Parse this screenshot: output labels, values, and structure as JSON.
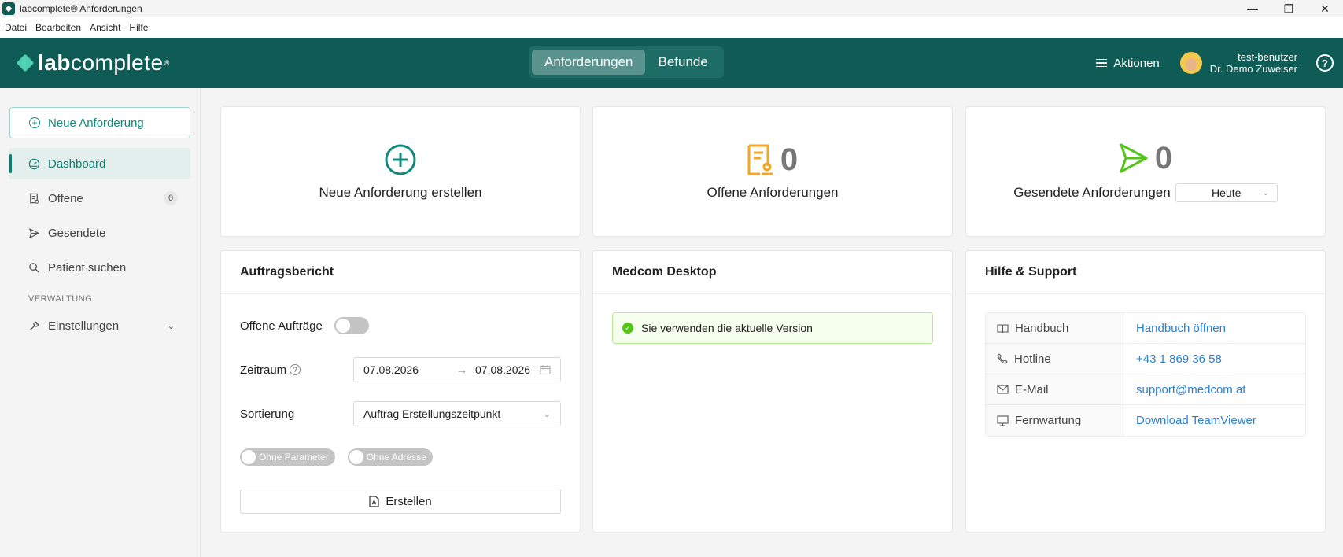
{
  "window": {
    "title": "labcomplete® Anforderungen",
    "minimize": "—",
    "maximize": "❐",
    "close": "✕"
  },
  "menu": [
    "Datei",
    "Bearbeiten",
    "Ansicht",
    "Hilfe"
  ],
  "header": {
    "logo_bold": "lab",
    "logo_rest": "complete",
    "logo_reg": "®",
    "tabs": [
      "Anforderungen",
      "Befunde"
    ],
    "active_tab": "Anforderungen",
    "actions_label": "Aktionen",
    "username": "test-benutzer",
    "doctor": "Dr. Demo Zuweiser",
    "help": "?"
  },
  "sidebar": {
    "new_button": "Neue Anforderung",
    "items": [
      {
        "label": "Dashboard",
        "icon": "dashboard-icon",
        "active": true
      },
      {
        "label": "Offene",
        "icon": "document-icon",
        "badge": "0"
      },
      {
        "label": "Gesendete",
        "icon": "send-icon"
      },
      {
        "label": "Patient suchen",
        "icon": "search-icon"
      }
    ],
    "section": "VERWALTUNG",
    "settings": "Einstellungen"
  },
  "stats": {
    "new_label": "Neue Anforderung erstellen",
    "open_count": "0",
    "open_label": "Offene Anforderungen",
    "sent_count": "0",
    "sent_label": "Gesendete Anforderungen",
    "period_select": "Heute"
  },
  "report": {
    "title": "Auftragsbericht",
    "open_orders_label": "Offene Aufträge",
    "period_label": "Zeitraum",
    "date_from": "07.08.2026",
    "date_to": "07.08.2026",
    "sort_label": "Sortierung",
    "sort_value": "Auftrag Erstellungszeitpunkt",
    "toggle_params": "Ohne Parameter",
    "toggle_address": "Ohne Adresse",
    "create_button": "Erstellen"
  },
  "medcom": {
    "title": "Medcom Desktop",
    "status": "Sie verwenden die aktuelle Version"
  },
  "support": {
    "title": "Hilfe & Support",
    "rows": [
      {
        "key": "Handbuch",
        "value": "Handbuch öffnen",
        "icon": "book-icon"
      },
      {
        "key": "Hotline",
        "value": "+43 1 869 36 58",
        "icon": "phone-icon"
      },
      {
        "key": "E-Mail",
        "value": "support@medcom.at",
        "icon": "mail-icon"
      },
      {
        "key": "Fernwartung",
        "value": "Download TeamViewer",
        "icon": "monitor-icon"
      }
    ]
  },
  "colors": {
    "brand": "#0f5c56",
    "accent": "#0f8a7a",
    "open": "#f5a623",
    "sent": "#52c41a"
  }
}
